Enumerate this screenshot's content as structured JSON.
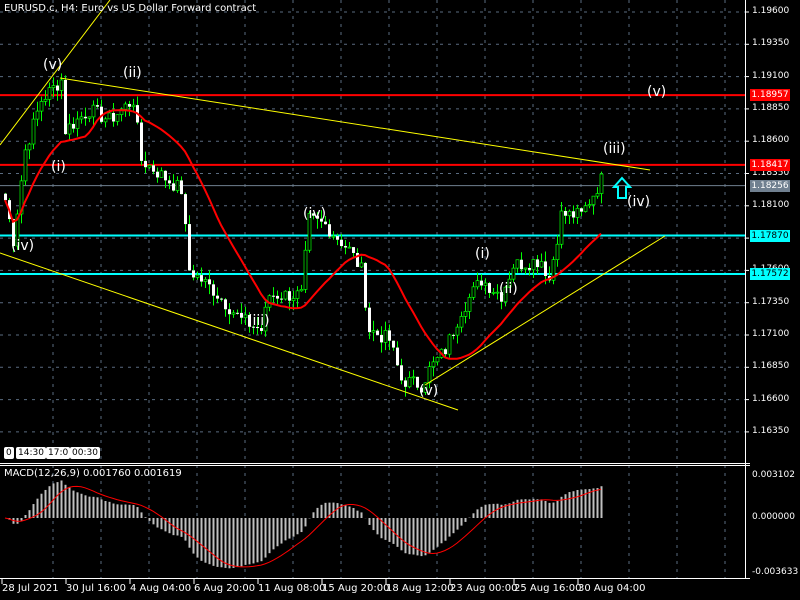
{
  "chart_title": "EURUSD.c, H4:  Euro vs US Dollar Forward contract",
  "price_axis": [
    "1.19600",
    "1.19350",
    "1.19100",
    "1.18850",
    "1.18600",
    "1.18350",
    "1.18100",
    "1.17850",
    "1.17600",
    "1.17350",
    "1.17100",
    "1.16850",
    "1.16600",
    "1.16350"
  ],
  "price_levels": [
    {
      "value": "1.18957",
      "color": "#ff0000"
    },
    {
      "value": "1.18417",
      "color": "#ff0000"
    },
    {
      "value": "1.18256",
      "color": "#708090"
    },
    {
      "value": "1.17870",
      "color": "#00ffff"
    },
    {
      "value": "1.17572",
      "color": "#00ffff"
    }
  ],
  "time_axis": [
    "28 Jul 2021",
    "30 Jul 16:00",
    "4 Aug 04:00",
    "6 Aug 20:00",
    "11 Aug 08:00",
    "15 Aug 20:00",
    "18 Aug 12:00",
    "23 Aug 00:00",
    "25 Aug 16:00",
    "30 Aug 04:00"
  ],
  "session_markers": [
    "0",
    "14:30",
    "17:0",
    "00:30"
  ],
  "macd": {
    "title": "MACD(12,26,9) 0.001760 0.001619",
    "axis": [
      "0.003102",
      "0.000000",
      "-0.003633"
    ]
  },
  "wave_labels": [
    {
      "text": "(v)",
      "bar": 12,
      "price": 1.1918
    },
    {
      "text": "(ii)",
      "bar": 32,
      "price": 1.1912
    },
    {
      "text": "(i)",
      "bar": 14,
      "price": 1.1839
    },
    {
      "text": "(iv)",
      "bar": 4,
      "price": 1.1778
    },
    {
      "text": "(iii)",
      "bar": 63,
      "price": 1.172
    },
    {
      "text": "(iv)",
      "bar": 77,
      "price": 1.1803
    },
    {
      "text": "(v)",
      "bar": 106,
      "price": 1.1666
    },
    {
      "text": "(i)",
      "bar": 120,
      "price": 1.1772
    },
    {
      "text": "(ii)",
      "bar": 126,
      "price": 1.1745
    },
    {
      "text": "(iii)",
      "bar": 152,
      "price": 1.1853
    },
    {
      "text": "(iv)",
      "bar": 158,
      "price": 1.1812
    },
    {
      "text": "(v)",
      "bar": 163,
      "price": 1.1897
    }
  ],
  "candle_keypoints": [
    [
      0,
      1.18145
    ],
    [
      2,
      1.17835
    ],
    [
      5,
      1.18532
    ],
    [
      9,
      1.18919
    ],
    [
      14,
      1.19074
    ],
    [
      15,
      1.18687
    ],
    [
      21,
      1.18842
    ],
    [
      26,
      1.18764
    ],
    [
      32,
      1.18919
    ],
    [
      34,
      1.18454
    ],
    [
      44,
      1.18222
    ],
    [
      46,
      1.17603
    ],
    [
      52,
      1.17448
    ],
    [
      59,
      1.17216
    ],
    [
      64,
      1.17139
    ],
    [
      66,
      1.1741
    ],
    [
      74,
      1.1741
    ],
    [
      76,
      1.1799
    ],
    [
      80,
      1.17951
    ],
    [
      86,
      1.17758
    ],
    [
      89,
      1.17603
    ],
    [
      91,
      1.17139
    ],
    [
      96,
      1.17061
    ],
    [
      99,
      1.16752
    ],
    [
      104,
      1.16713
    ],
    [
      106,
      1.1683
    ],
    [
      110,
      1.16984
    ],
    [
      114,
      1.17294
    ],
    [
      119,
      1.17526
    ],
    [
      124,
      1.1741
    ],
    [
      127,
      1.17642
    ],
    [
      134,
      1.17681
    ],
    [
      136,
      1.17526
    ],
    [
      139,
      1.18029
    ],
    [
      144,
      1.18029
    ],
    [
      149,
      1.183
    ]
  ],
  "colors": {
    "bull": "#00ff00",
    "bear": "#ffffff",
    "ma": "#ff0000",
    "trend": "#ffff00",
    "grid": "#5a6b80",
    "signal": "#ff0000",
    "hist": "#c0c0c0"
  }
}
